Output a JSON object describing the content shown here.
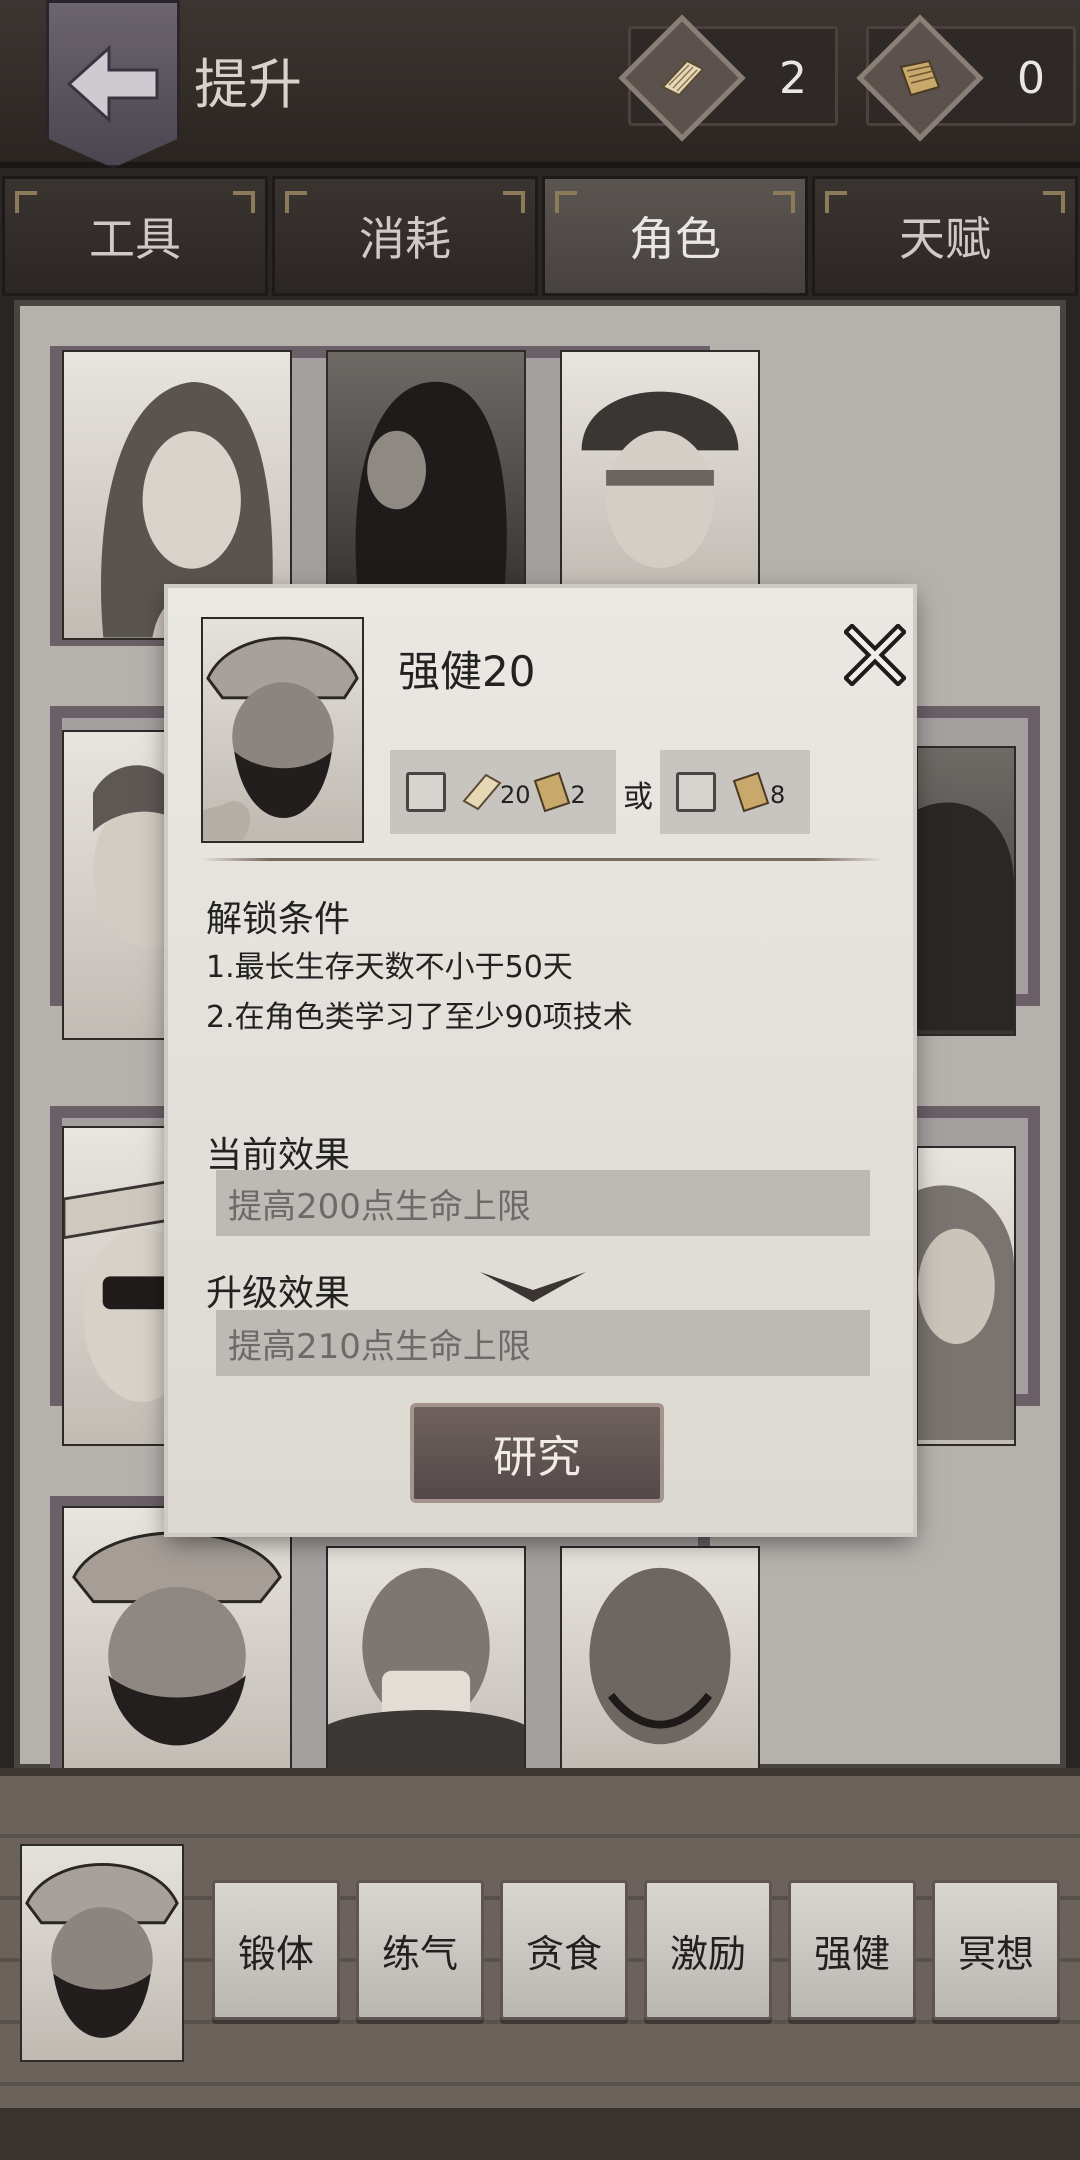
{
  "header": {
    "title": "提升",
    "back_icon": "back-arrow-icon",
    "currencies": [
      {
        "icon": "paper-icon",
        "count": "2"
      },
      {
        "icon": "scroll-icon",
        "count": "0"
      }
    ]
  },
  "tabs": [
    {
      "label": "工具",
      "active": false
    },
    {
      "label": "消耗",
      "active": false
    },
    {
      "label": "角色",
      "active": true
    },
    {
      "label": "天赋",
      "active": false
    }
  ],
  "modal": {
    "title": "强健20",
    "cost_option_a": {
      "paper_count": "20",
      "scroll_count": "2"
    },
    "or_label": "或",
    "cost_option_b": {
      "scroll_count": "8"
    },
    "unlock_heading": "解锁条件",
    "conditions": [
      "1.最长生存天数不小于50天",
      "2.在角色类学习了至少90项技术"
    ],
    "current_effect_heading": "当前效果",
    "current_effect": "提高200点生命上限",
    "upgrade_effect_heading": "升级效果",
    "upgrade_effect": "提高210点生命上限",
    "research_label": "研究"
  },
  "skills": [
    "锻体",
    "练气",
    "贪食",
    "激励",
    "强健",
    "冥想"
  ],
  "colors": {
    "header_bg": "#3c3532",
    "board_frame": "#6c6068",
    "button_bg": "#6f625d",
    "paper": "#ebe8e3"
  }
}
